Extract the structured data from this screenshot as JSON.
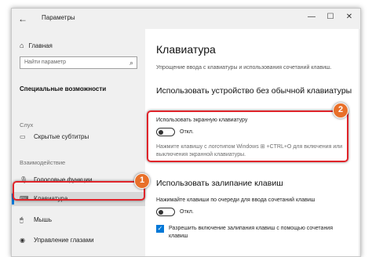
{
  "window": {
    "title": "Параметры",
    "back_icon": "←",
    "minimize_icon": "—",
    "maximize_icon": "☐",
    "close_icon": "✕"
  },
  "sidebar": {
    "home_label": "Главная",
    "home_icon": "⌂",
    "search_placeholder": "Найти параметр",
    "search_icon": "⌕",
    "section_title": "Специальные возможности",
    "groups": [
      {
        "label": "Слух",
        "items": [
          {
            "label": "Скрытые субтитры",
            "icon": "▭"
          }
        ]
      },
      {
        "label": "Взаимодействие",
        "items": [
          {
            "label": "Голосовые функции",
            "icon": "🎙"
          },
          {
            "label": "Клавиатура",
            "icon": "⌨"
          },
          {
            "label": "Мышь",
            "icon": "🖱"
          },
          {
            "label": "Управление глазами",
            "icon": "◉"
          }
        ]
      }
    ],
    "active_item": "Клавиатура"
  },
  "main": {
    "title": "Клавиатура",
    "subtitle": "Упрощение ввода с клавиатуры и использования сочетаний клавиш.",
    "section1": {
      "heading": "Использовать устройство без обычной клавиатуры",
      "option_label": "Использовать экранную клавиатуру",
      "toggle_state": "Откл.",
      "hint": "Нажмите клавишу с логотипом Windows ⊞ +CTRL+O для включения или выключения экранной клавиатуры."
    },
    "section2": {
      "heading": "Использовать залипание клавиш",
      "option_label": "Нажимайте клавиши по очереди для ввода сочетаний клавиш",
      "toggle_state": "Откл.",
      "checkbox_label": "Разрешить включение залипания клавиш с помощью сочетания клавиш",
      "checkbox_checked": true
    }
  },
  "annotations": {
    "marker1": "1",
    "marker2": "2",
    "highlight_color": "#e0242a",
    "marker_color": "#e8702a"
  },
  "colors": {
    "accent": "#0078d7",
    "sidebar_bg": "#f0f0f0"
  }
}
